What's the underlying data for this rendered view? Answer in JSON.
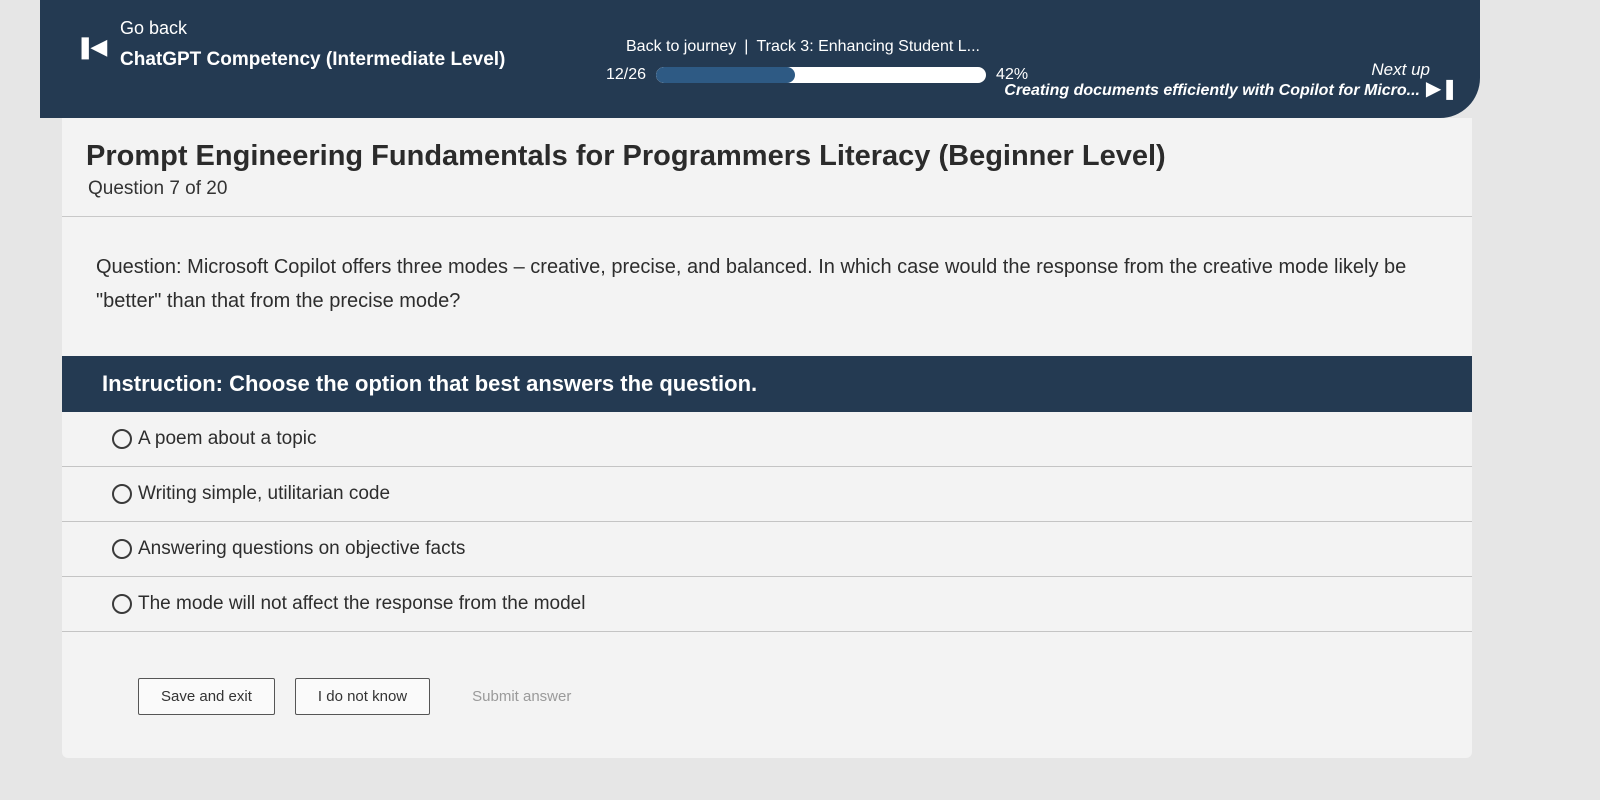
{
  "header": {
    "go_back_label": "Go back",
    "course_title": "ChatGPT Competency (Intermediate Level)",
    "back_to_journey": "Back to journey",
    "separator": "|",
    "track": "Track 3: Enhancing Student L...",
    "progress_count": "12/26",
    "progress_percent_label": "42%",
    "progress_fraction": 0.42,
    "next_up_label": "Next up",
    "next_title": "Creating documents efficiently with Copilot for Micro..."
  },
  "quiz": {
    "title": "Prompt Engineering Fundamentals for Programmers Literacy (Beginner Level)",
    "counter": "Question 7 of 20",
    "question": "Question: Microsoft Copilot offers three modes – creative, precise, and balanced. In which case would the response from the creative mode likely be \"better\" than that from the precise mode?",
    "instruction": "Instruction: Choose the option that best answers the question.",
    "options": [
      "A poem about a topic",
      "Writing simple, utilitarian code",
      "Answering questions on objective facts",
      "The mode will not affect the response from the model"
    ]
  },
  "actions": {
    "save_exit": "Save and exit",
    "dont_know": "I do not know",
    "submit": "Submit answer"
  },
  "icons": {
    "previous": "skip-back-icon",
    "next": "skip-forward-icon",
    "radio": "radio-unchecked-icon"
  },
  "colors": {
    "header_bg": "#243a52",
    "progress_fill": "#2e5a84"
  }
}
